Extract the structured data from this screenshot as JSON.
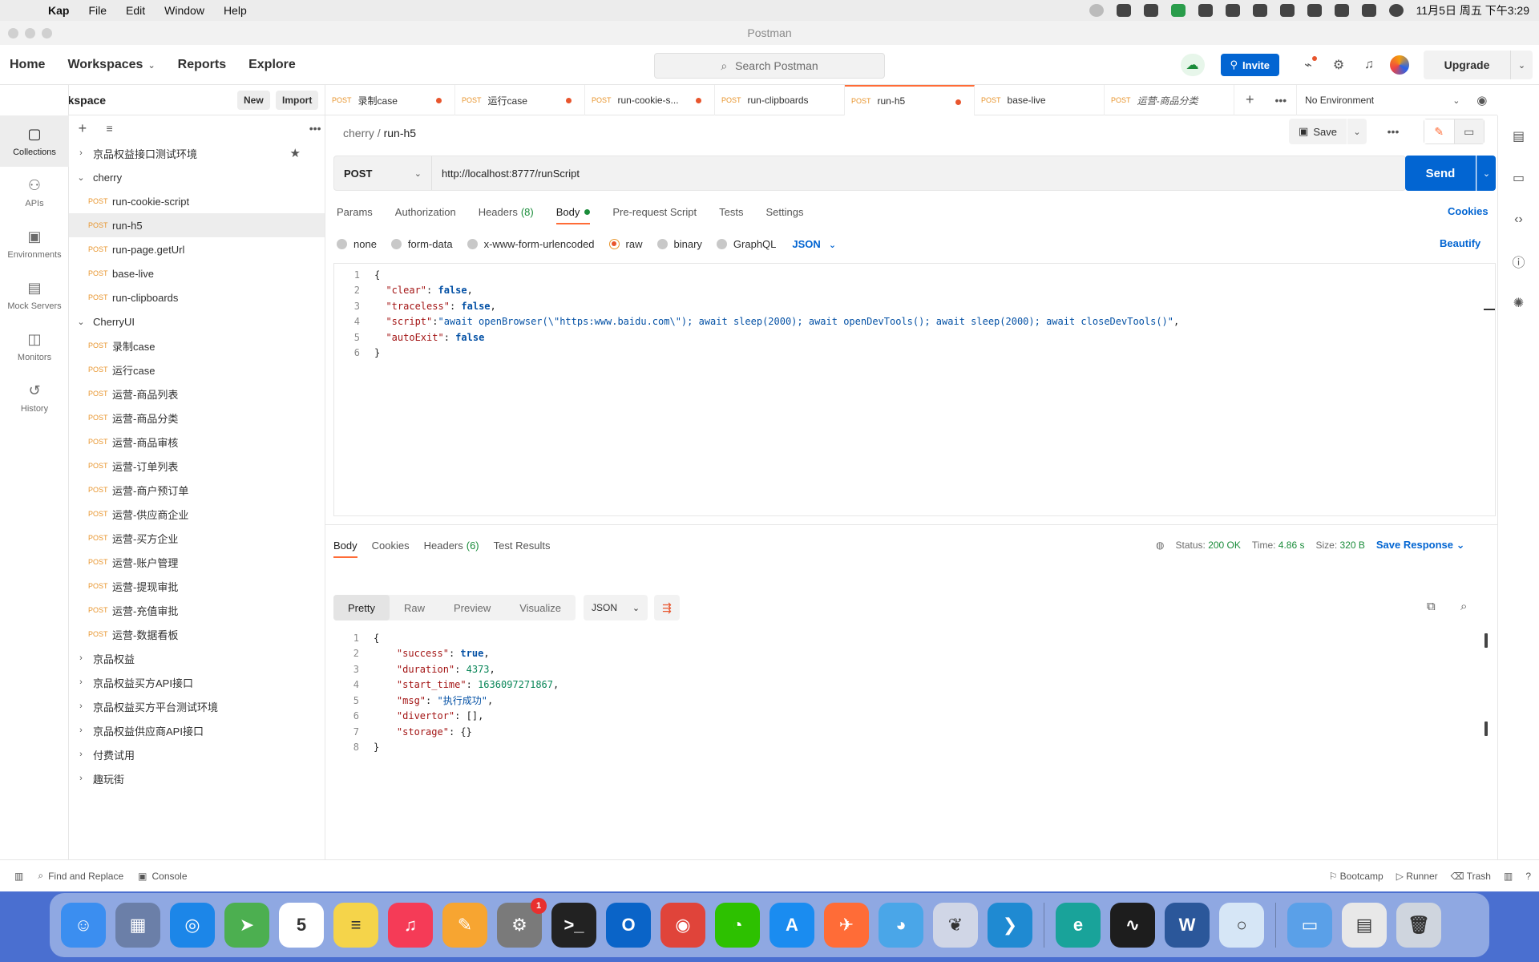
{
  "menubar": {
    "app_name": "Kap",
    "items": [
      "File",
      "Edit",
      "Window",
      "Help"
    ],
    "clock": "11月5日 周五 下午3:29"
  },
  "window": {
    "title": "Postman"
  },
  "appbar": {
    "home": "Home",
    "workspaces": "Workspaces",
    "reports": "Reports",
    "explore": "Explore",
    "search_placeholder": "Search Postman",
    "invite": "Invite",
    "upgrade": "Upgrade"
  },
  "workspace": {
    "title": "My Workspace",
    "new_label": "New",
    "import_label": "Import"
  },
  "rail": [
    {
      "label": "Collections",
      "icon": "collections-icon",
      "glyph": "▢",
      "active": true
    },
    {
      "label": "APIs",
      "icon": "apis-icon",
      "glyph": "⚇",
      "active": false
    },
    {
      "label": "Environments",
      "icon": "environments-icon",
      "glyph": "▣",
      "active": false
    },
    {
      "label": "Mock Servers",
      "icon": "mock-servers-icon",
      "glyph": "▤",
      "active": false
    },
    {
      "label": "Monitors",
      "icon": "monitors-icon",
      "glyph": "◫",
      "active": false
    },
    {
      "label": "History",
      "icon": "history-icon",
      "glyph": "↺",
      "active": false
    }
  ],
  "tree": [
    {
      "type": "folder",
      "label": "京品权益接口测试环境",
      "open": false,
      "starred": true
    },
    {
      "type": "folder",
      "label": "cherry",
      "open": true
    },
    {
      "type": "request",
      "method": "POST",
      "label": "run-cookie-script"
    },
    {
      "type": "request",
      "method": "POST",
      "label": "run-h5",
      "active": true
    },
    {
      "type": "request",
      "method": "POST",
      "label": "run-page.getUrl"
    },
    {
      "type": "request",
      "method": "POST",
      "label": "base-live"
    },
    {
      "type": "request",
      "method": "POST",
      "label": "run-clipboards"
    },
    {
      "type": "folder",
      "label": "CherryUI",
      "open": true
    },
    {
      "type": "request",
      "method": "POST",
      "label": "录制case"
    },
    {
      "type": "request",
      "method": "POST",
      "label": "运行case"
    },
    {
      "type": "request",
      "method": "POST",
      "label": "运营-商品列表"
    },
    {
      "type": "request",
      "method": "POST",
      "label": "运营-商品分类"
    },
    {
      "type": "request",
      "method": "POST",
      "label": "运营-商品审核"
    },
    {
      "type": "request",
      "method": "POST",
      "label": "运营-订单列表"
    },
    {
      "type": "request",
      "method": "POST",
      "label": "运营-商户预订单"
    },
    {
      "type": "request",
      "method": "POST",
      "label": "运营-供应商企业"
    },
    {
      "type": "request",
      "method": "POST",
      "label": "运营-买方企业"
    },
    {
      "type": "request",
      "method": "POST",
      "label": "运营-账户管理"
    },
    {
      "type": "request",
      "method": "POST",
      "label": "运营-提现审批"
    },
    {
      "type": "request",
      "method": "POST",
      "label": "运营-充值审批"
    },
    {
      "type": "request",
      "method": "POST",
      "label": "运营-数据看板"
    },
    {
      "type": "folder",
      "label": "京品权益",
      "open": false
    },
    {
      "type": "folder",
      "label": "京品权益买方API接口",
      "open": false
    },
    {
      "type": "folder",
      "label": "京品权益买方平台测试环境",
      "open": false
    },
    {
      "type": "folder",
      "label": "京品权益供应商API接口",
      "open": false
    },
    {
      "type": "folder",
      "label": "付费试用",
      "open": false
    },
    {
      "type": "folder",
      "label": "趣玩街",
      "open": false
    }
  ],
  "tabs": [
    {
      "method": "POST",
      "label": "录制case",
      "dirty": true
    },
    {
      "method": "POST",
      "label": "运行case",
      "dirty": true
    },
    {
      "method": "POST",
      "label": "run-cookie-s...",
      "dirty": true
    },
    {
      "method": "POST",
      "label": "run-clipboards",
      "dirty": false
    },
    {
      "method": "POST",
      "label": "run-h5",
      "dirty": true,
      "active": true
    },
    {
      "method": "POST",
      "label": "base-live",
      "dirty": false
    },
    {
      "method": "POST",
      "label": "运营-商品分类",
      "dirty": false,
      "italic": true
    }
  ],
  "environment": "No Environment",
  "request": {
    "breadcrumb_parent": "cherry",
    "breadcrumb_current": "run-h5",
    "save": "Save",
    "method": "POST",
    "url": "http://localhost:8777/runScript",
    "send": "Send",
    "tabs": [
      {
        "label": "Params",
        "count": ""
      },
      {
        "label": "Authorization",
        "count": ""
      },
      {
        "label": "Headers",
        "count": "(8)"
      },
      {
        "label": "Body",
        "count": "",
        "active": true,
        "dot": true
      },
      {
        "label": "Pre-request Script",
        "count": ""
      },
      {
        "label": "Tests",
        "count": ""
      },
      {
        "label": "Settings",
        "count": ""
      }
    ],
    "cookies": "Cookies",
    "body_types": [
      {
        "label": "none",
        "on": false
      },
      {
        "label": "form-data",
        "on": false
      },
      {
        "label": "x-www-form-urlencoded",
        "on": false
      },
      {
        "label": "raw",
        "on": true
      },
      {
        "label": "binary",
        "on": false
      },
      {
        "label": "GraphQL",
        "on": false
      }
    ],
    "body_format": "JSON",
    "beautify": "Beautify",
    "body_lines": [
      "{",
      "  \"clear\": false,",
      "  \"traceless\": false,",
      "  \"script\":\"await openBrowser(\\\"https:www.baidu.com\\\"); await sleep(2000); await openDevTools(); await sleep(2000); await closeDevTools()\",",
      "  \"autoExit\": false",
      "}"
    ]
  },
  "response": {
    "tabs": [
      {
        "label": "Body",
        "count": "",
        "active": true
      },
      {
        "label": "Cookies",
        "count": ""
      },
      {
        "label": "Headers",
        "count": "(6)"
      },
      {
        "label": "Test Results",
        "count": ""
      }
    ],
    "status_label": "Status:",
    "status": "200 OK",
    "time_label": "Time:",
    "time": "4.86 s",
    "size_label": "Size:",
    "size": "320 B",
    "save_response": "Save Response",
    "formats": [
      "Pretty",
      "Raw",
      "Preview",
      "Visualize"
    ],
    "format_type": "JSON",
    "lines": [
      "{",
      "    \"success\": true,",
      "    \"duration\": 4373,",
      "    \"start_time\": 1636097271867,",
      "    \"msg\": \"执行成功\",",
      "    \"divertor\": [],",
      "    \"storage\": {}",
      "}"
    ]
  },
  "statusbar": {
    "find_replace": "Find and Replace",
    "console": "Console",
    "bootcamp": "Bootcamp",
    "runner": "Runner",
    "trash": "Trash"
  },
  "dock": [
    {
      "name": "finder-icon",
      "color": "#3b8ef0",
      "glyph": "☺"
    },
    {
      "name": "launchpad-icon",
      "color": "#6b7fa8",
      "glyph": "▦"
    },
    {
      "name": "safari-icon",
      "color": "#1c86e8",
      "glyph": "◎"
    },
    {
      "name": "maps-icon",
      "color": "#4caf50",
      "glyph": "➤"
    },
    {
      "name": "calendar-icon",
      "color": "#ffffff",
      "glyph": "5"
    },
    {
      "name": "notes-icon",
      "color": "#f5d44a",
      "glyph": "≡"
    },
    {
      "name": "music-icon",
      "color": "#f53b57",
      "glyph": "♫"
    },
    {
      "name": "pages-icon",
      "color": "#f7a531",
      "glyph": "✎"
    },
    {
      "name": "system-preferences-icon",
      "color": "#7a7a7a",
      "glyph": "⚙",
      "badge": "1"
    },
    {
      "name": "terminal-icon",
      "color": "#222222",
      "glyph": ">_"
    },
    {
      "name": "outlook-icon",
      "color": "#0a64c8",
      "glyph": "O"
    },
    {
      "name": "chrome-icon",
      "color": "#e0443a",
      "glyph": "◉"
    },
    {
      "name": "wechat-icon",
      "color": "#2dc100",
      "glyph": "◔"
    },
    {
      "name": "appstore-icon",
      "color": "#1a8cf0",
      "glyph": "A"
    },
    {
      "name": "postman-icon",
      "color": "#ff6c37",
      "glyph": "✈"
    },
    {
      "name": "qq-icon",
      "color": "#4aa6e8",
      "glyph": "◕"
    },
    {
      "name": "cherry-icon",
      "color": "#d0d6e6",
      "glyph": "❦"
    },
    {
      "name": "vscode-icon",
      "color": "#1f8ad2",
      "glyph": "❯"
    },
    {
      "name": "eset-icon",
      "color": "#19a39a",
      "glyph": "e"
    },
    {
      "name": "activity-monitor-icon",
      "color": "#1d1d1d",
      "glyph": "∿"
    },
    {
      "name": "word-icon",
      "color": "#2b579a",
      "glyph": "W"
    },
    {
      "name": "circle-app-icon",
      "color": "#d6e6f6",
      "glyph": "○"
    },
    {
      "name": "folder-icon",
      "color": "#5aa0e8",
      "glyph": "▭"
    },
    {
      "name": "preview-icon",
      "color": "#e8e8e8",
      "glyph": "▤"
    },
    {
      "name": "trash-icon",
      "color": "#cfd5de",
      "glyph": "🗑"
    }
  ]
}
